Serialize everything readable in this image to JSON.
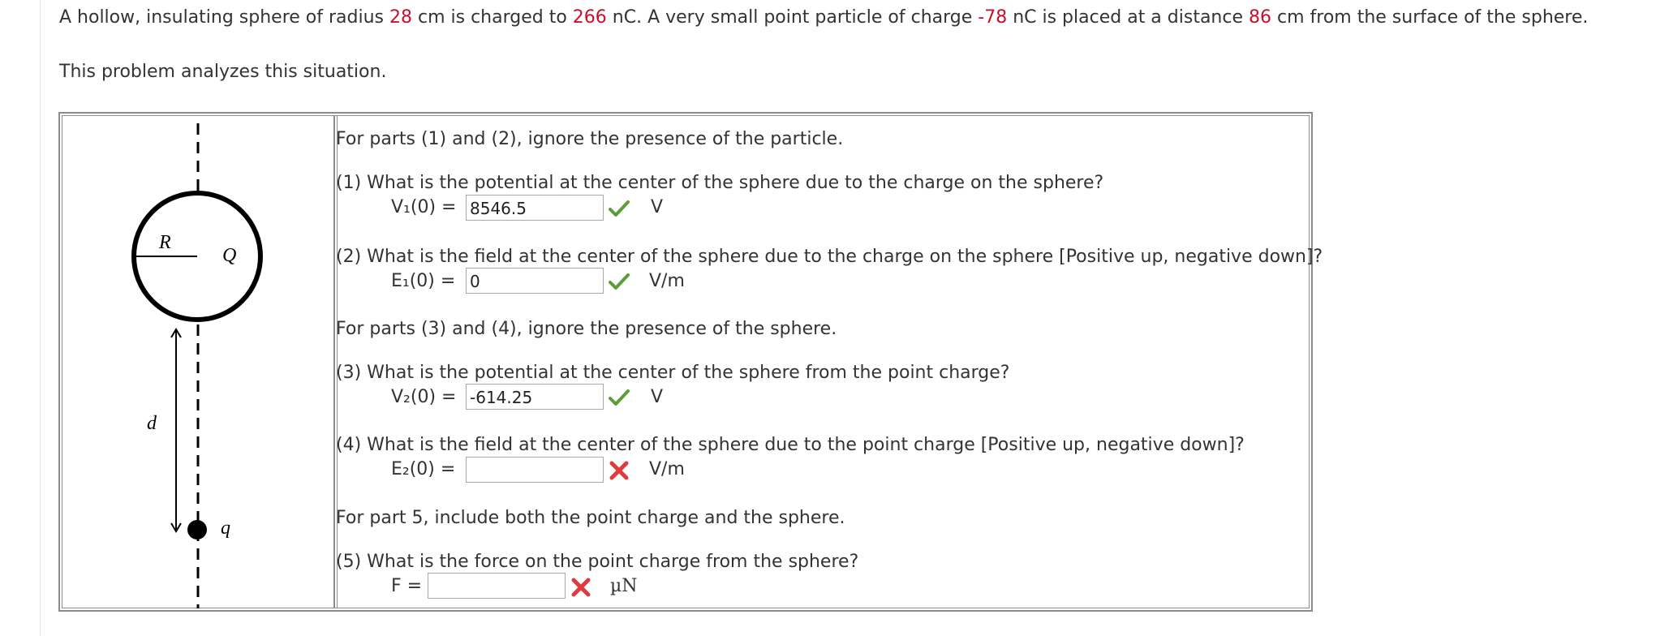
{
  "intro": {
    "t1": "A hollow, insulating sphere of radius ",
    "radius": "28",
    "t2": " cm is charged to ",
    "sphere_charge": "266",
    "t3": " nC. A very small point particle of charge ",
    "point_charge": "-78",
    "t4": " nC is placed at a distance ",
    "distance": "86",
    "t5": " cm from the surface of the sphere."
  },
  "analysis": "This problem analyzes this situation.",
  "diagram": {
    "R": "R",
    "Q": "Q",
    "d": "d",
    "q": "q"
  },
  "part12_note": "For parts (1) and (2), ignore the presence of the particle.",
  "part34_note": "For parts (3) and (4), ignore the presence of the sphere.",
  "part5_note": "For part 5, include both the point charge and the sphere.",
  "questions": [
    {
      "text": "(1) What is the potential at the center of the sphere due to the charge on the sphere?",
      "label": "V₁(0)  =",
      "value": "8546.5",
      "unit": "V",
      "status": "correct"
    },
    {
      "text": "(2) What is the field at the center of the sphere due to the charge on the sphere [Positive up, negative down]?",
      "label": "E₁(0)  =",
      "value": "0",
      "unit": "V/m",
      "status": "correct"
    },
    {
      "text": "(3) What is the potential at the center of the sphere from the point charge?",
      "label": "V₂(0)  =",
      "value": "-614.25",
      "unit": "V",
      "status": "correct"
    },
    {
      "text": "(4) What is the field at the center of the sphere due to the point charge [Positive up, negative down]?",
      "label": "E₂(0)  =",
      "value": "",
      "unit": "V/m",
      "status": "incorrect"
    },
    {
      "text": "(5) What is the force on the point charge from the sphere?",
      "label": "F  =",
      "value": "",
      "unit": "µN",
      "status": "incorrect"
    }
  ],
  "colors": {
    "highlight": "#c8102e",
    "correct": "#5a9e3a",
    "incorrect": "#e23a3a",
    "border": "#8c8c8c"
  }
}
